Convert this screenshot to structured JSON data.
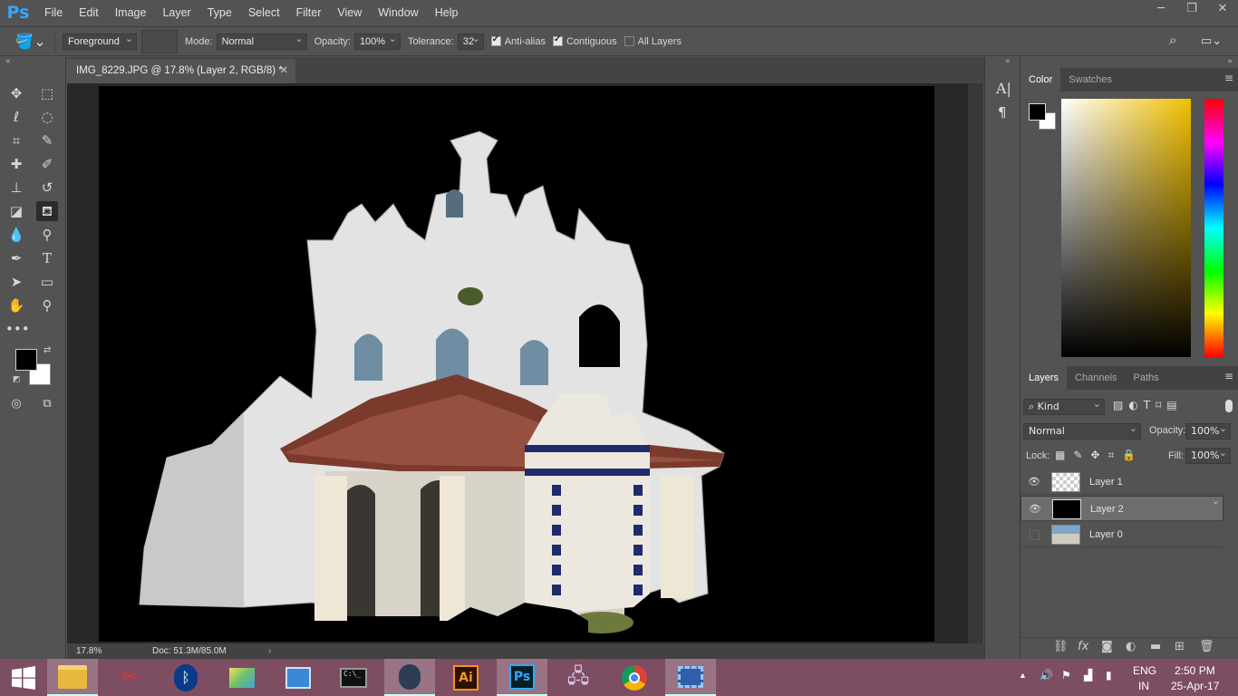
{
  "app": {
    "logo": "Ps"
  },
  "menu": [
    "File",
    "Edit",
    "Image",
    "Layer",
    "Type",
    "Select",
    "Filter",
    "View",
    "Window",
    "Help"
  ],
  "window_controls": {
    "minimize": "─",
    "restore": "❐",
    "close": "✕"
  },
  "options": {
    "fill_source": "Foreground",
    "mode_label": "Mode:",
    "mode_value": "Normal",
    "opacity_label": "Opacity:",
    "opacity_value": "100%",
    "tolerance_label": "Tolerance:",
    "tolerance_value": "32",
    "antialias_label": "Anti-alias",
    "contiguous_label": "Contiguous",
    "all_layers_label": "All Layers"
  },
  "document": {
    "tab_title": "IMG_8229.JPG @ 17.8% (Layer 2, RGB/8) *",
    "zoom": "17.8%",
    "doc_size": "Doc: 51.3M/85.0M"
  },
  "color_panel": {
    "tabs": [
      "Color",
      "Swatches"
    ],
    "fg": "#000000",
    "bg": "#ffffff"
  },
  "layers_panel": {
    "tabs": [
      "Layers",
      "Channels",
      "Paths"
    ],
    "kind": "Kind",
    "blend_mode": "Normal",
    "opacity_label": "Opacity:",
    "opacity_value": "100%",
    "lock_label": "Lock:",
    "fill_label": "Fill:",
    "fill_value": "100%",
    "layers": [
      {
        "name": "Layer 1",
        "visible": true,
        "selected": false
      },
      {
        "name": "Layer 2",
        "visible": true,
        "selected": true
      },
      {
        "name": "Layer 0",
        "visible": false,
        "selected": false
      }
    ]
  },
  "taskbar": {
    "lang1": "ENG",
    "lang2": "IN",
    "time": "2:50 PM",
    "date": "25-Apr-17",
    "ai_label": "Ai",
    "ps_label": "Ps"
  }
}
